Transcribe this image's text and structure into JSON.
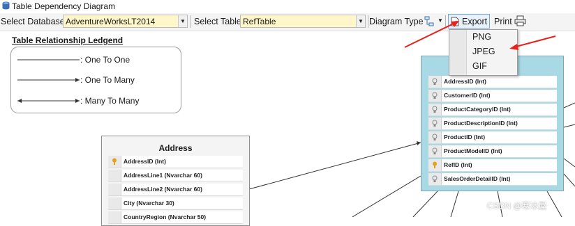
{
  "window": {
    "title": "Table Dependency Diagram"
  },
  "toolbar": {
    "select_database_label": "Select Database",
    "database_value": "AdventureWorksLT2014",
    "select_table_label": "Select Table",
    "table_value": "RefTable",
    "diagram_type_label": "Diagram Type",
    "export_label": "Export",
    "print_label": "Print"
  },
  "export_menu": {
    "items": [
      "PNG",
      "JPEG",
      "GIF"
    ]
  },
  "legend": {
    "title": "Table Relationship Ledgend",
    "items": [
      ": One To One",
      ": One To Many",
      ": Many To Many"
    ]
  },
  "tables": {
    "address": {
      "title": "Address",
      "rows": [
        {
          "text": "AddressID (Int)",
          "key": true
        },
        {
          "text": "AddressLine1 (Nvarchar 60)",
          "key": false
        },
        {
          "text": "AddressLine2 (Nvarchar 60)",
          "key": false
        },
        {
          "text": "City (Nvarchar 30)",
          "key": false
        },
        {
          "text": "CountryRegion (Nvarchar 50)",
          "key": false
        }
      ]
    },
    "reftable": {
      "rows": [
        {
          "text": "AddressID (Int)",
          "key": false
        },
        {
          "text": "CustomerID (Int)",
          "key": false
        },
        {
          "text": "ProductCategoryID (Int)",
          "key": false
        },
        {
          "text": "ProductDescriptionID (Int)",
          "key": false
        },
        {
          "text": "ProductID (Int)",
          "key": false
        },
        {
          "text": "ProductModelID (Int)",
          "key": false
        },
        {
          "text": "RefID (Int)",
          "key": true
        },
        {
          "text": "SalesOrderDetailID (Int)",
          "key": false
        }
      ]
    }
  },
  "watermark": "CSDN @寒冰屋",
  "colors": {
    "combo_bg": "#fff6c9",
    "reftable_bg": "#a9d9e5",
    "annotation_arrow": "#e8201a",
    "key_icon": "#e3a11d"
  }
}
